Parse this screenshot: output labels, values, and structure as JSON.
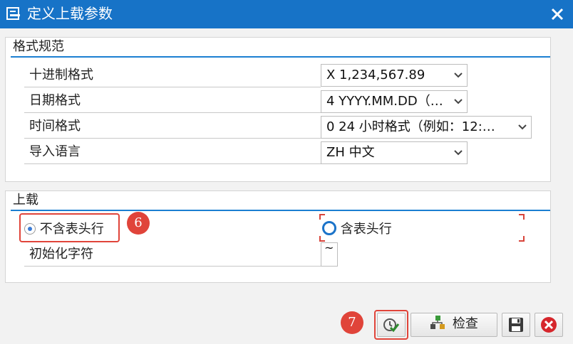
{
  "window": {
    "title": "定义上载参数"
  },
  "format_group": {
    "title": "格式规范",
    "rows": [
      {
        "label": "十进制格式",
        "value": "X 1,234,567.89"
      },
      {
        "label": "日期格式",
        "value": "4 YYYY.MM.DD（…"
      },
      {
        "label": "时间格式",
        "value": "0 24 小时格式（例如：12:…"
      },
      {
        "label": "导入语言",
        "value": "ZH 中文"
      }
    ]
  },
  "upload_group": {
    "title": "上载",
    "radio_no_header": "不含表头行",
    "radio_with_header": "含表头行",
    "init_char_label": "初始化字符",
    "init_char_value": "~"
  },
  "callouts": {
    "step6": "6",
    "step7": "7"
  },
  "buttons": {
    "check_label": "检查"
  },
  "colors": {
    "titlebar": "#1773c7",
    "accent": "#1b7fd1",
    "callout": "#e0443a"
  }
}
